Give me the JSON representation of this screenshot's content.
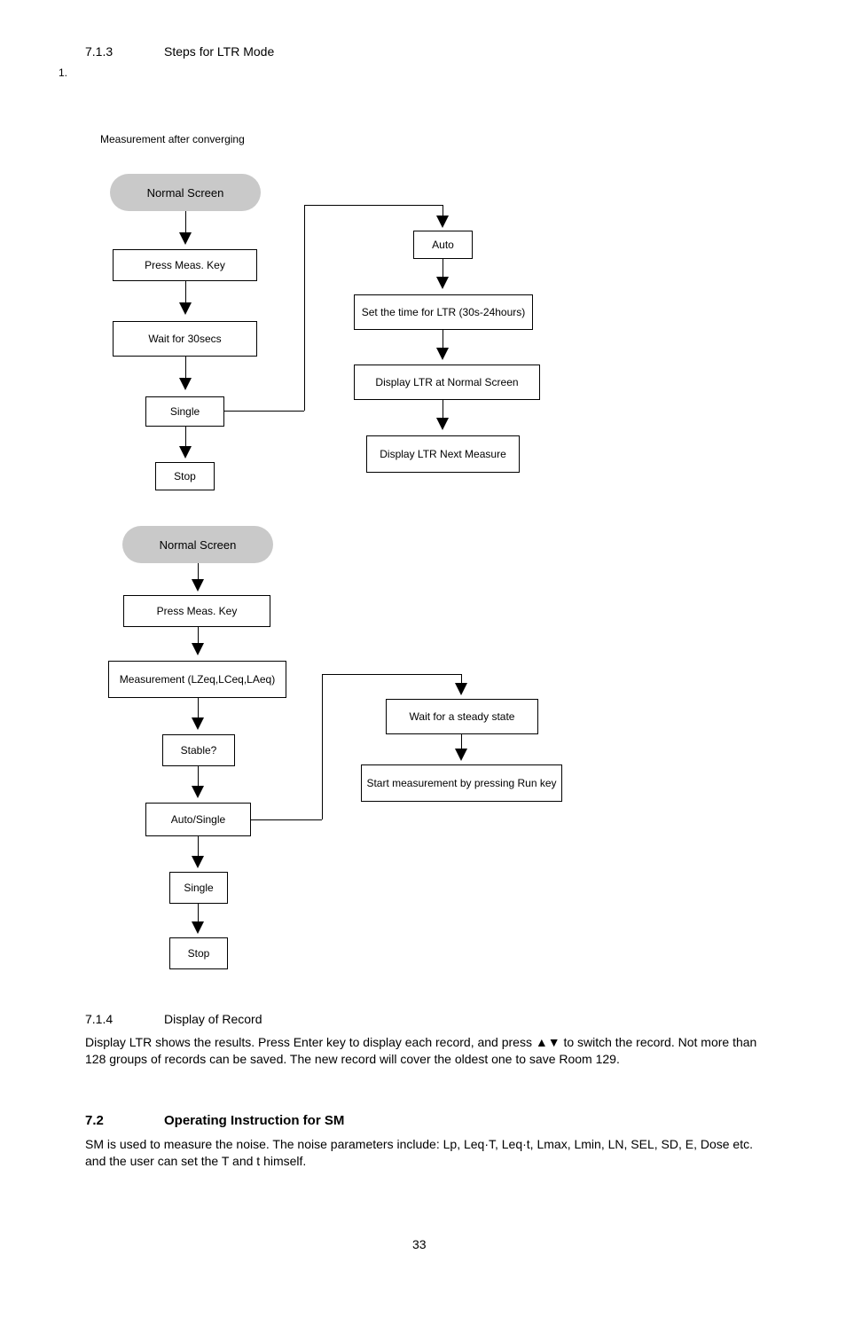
{
  "section713": {
    "number": "7.1.3",
    "title": "Steps for LTR Mode",
    "regions_caption": "1.",
    "region1": {
      "caption": "Measurement after converging"
    },
    "flowA": {
      "start": "Normal Screen",
      "b1": "Press Meas. Key",
      "b2": "Wait for 30secs",
      "b3": "Single",
      "b4": "Stop"
    },
    "flowB": {
      "b1": "Auto",
      "b2": "Set the time for LTR (30s-24hours)",
      "b3": "Display LTR at Normal Screen",
      "b4": "Display LTR Next Measure"
    },
    "flowC": {
      "start": "Normal Screen",
      "b1": "Press Meas. Key",
      "b2": "Measurement (LZeq,LCeq,LAeq)",
      "b3": "Stable?",
      "b4": "Auto/Single",
      "b5": "Single",
      "b6": "Stop"
    },
    "flowD": {
      "b1": "Wait for a steady state",
      "b2": "Start measurement by pressing Run key"
    }
  },
  "section714": {
    "number": "7.1.4",
    "title": "Display of Record",
    "paragraph": "Display LTR shows the results. Press Enter key to display each record, and press ▲▼ to switch the record. Not more than 128 groups of records can be saved. The new record will cover the oldest one to save Room 129."
  },
  "section72": {
    "number": "7.2",
    "title": "Operating Instruction for SM",
    "paragraph": "SM is used to measure the noise. The noise parameters include: Lp, Leq·T, Leq·t, Lmax, Lmin, LN, SEL, SD, E, Dose etc. and the user can set the T and t himself."
  },
  "footer": {
    "page": "33"
  }
}
